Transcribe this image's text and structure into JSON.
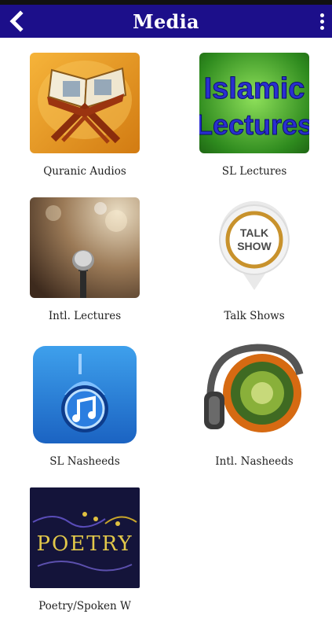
{
  "app": {
    "title": "Media"
  },
  "icons": {
    "back": "chevron-left-icon",
    "more": "more-vertical-icon"
  },
  "items": [
    {
      "label": "Quranic Audios",
      "icon": "quran-rehal-icon"
    },
    {
      "label": "SL Lectures",
      "icon": "islamic-lectures-icon",
      "art_text": [
        "Islamic",
        "Lectures"
      ]
    },
    {
      "label": "Intl. Lectures",
      "icon": "microphone-icon"
    },
    {
      "label": "Talk Shows",
      "icon": "talk-show-pin-icon",
      "art_text": [
        "TALK",
        "SHOW"
      ]
    },
    {
      "label": "SL Nasheeds",
      "icon": "music-mosque-icon"
    },
    {
      "label": "Intl. Nasheeds",
      "icon": "headphones-quran-icon"
    },
    {
      "label": "Poetry/Spoken W",
      "icon": "poetry-icon",
      "art_text": [
        "POETRY"
      ]
    }
  ],
  "colors": {
    "appbar": "#1c0f8a",
    "text": "#222222"
  }
}
